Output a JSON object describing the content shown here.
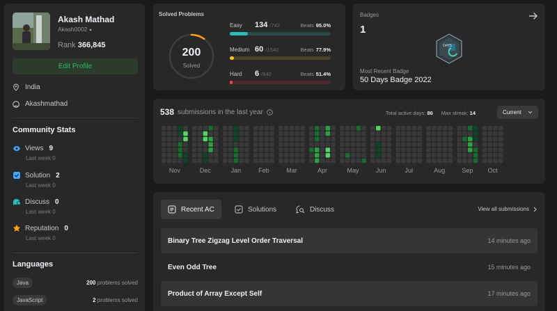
{
  "profile": {
    "name": "Akash Mathad",
    "handle": "Akash0002",
    "rank_label": "Rank",
    "rank_value": "366,845",
    "edit_label": "Edit Profile",
    "location": "India",
    "github": "Akashmathad"
  },
  "community": {
    "title": "Community Stats",
    "items": [
      {
        "label": "Views",
        "value": "9",
        "sub": "Last week 0",
        "icon": "eye-icon",
        "color": "#3ea6ff"
      },
      {
        "label": "Solution",
        "value": "2",
        "sub": "Last week 0",
        "icon": "solution-check-icon",
        "color": "#3ea6ff"
      },
      {
        "label": "Discuss",
        "value": "0",
        "sub": "Last week 0",
        "icon": "discuss-icon",
        "color": "#2cbbb8"
      },
      {
        "label": "Reputation",
        "value": "0",
        "sub": "Last week 0",
        "icon": "star-icon",
        "color": "#ffa116"
      }
    ]
  },
  "languages": {
    "title": "Languages",
    "items": [
      {
        "name": "Java",
        "count": "200",
        "suffix": "problems solved"
      },
      {
        "name": "JavaScript",
        "count": "2",
        "suffix": "problems solved"
      }
    ]
  },
  "solved": {
    "title": "Solved Problems",
    "total": "200",
    "total_label": "Solved",
    "ring_fraction": 0.1,
    "difficulties": [
      {
        "name": "Easy",
        "solved": "134",
        "total": "/742",
        "beats_label": "Beats",
        "beats": "95.0%",
        "fraction": 0.181,
        "fill": "#2cbbb8",
        "track": "#2a4a47"
      },
      {
        "name": "Medium",
        "solved": "60",
        "total": "/1540",
        "beats_label": "Beats",
        "beats": "77.9%",
        "fraction": 0.039,
        "fill": "#ffc01e",
        "track": "#4d4226"
      },
      {
        "name": "Hard",
        "solved": "6",
        "total": "/640",
        "beats_label": "Beats",
        "beats": "51.4%",
        "fraction": 0.009,
        "fill": "#ef4743",
        "track": "#4d2a29"
      }
    ]
  },
  "badges": {
    "label": "Badges",
    "count": "1",
    "recent_label": "Most Recent Badge",
    "recent_name": "50 Days Badge 2022",
    "badge_text": "DAYS"
  },
  "submissions": {
    "count": "538",
    "label": "submissions in the last year",
    "active_label": "Total active days:",
    "active_value": "86",
    "streak_label": "Max streak:",
    "streak_value": "14",
    "period": "Current",
    "months": [
      "Nov",
      "Dec",
      "Jan",
      "Feb",
      "Mar",
      "Apr",
      "May",
      "Jun",
      "Jul",
      "Aug",
      "Sep",
      "Oct"
    ],
    "levels": [
      "#393939",
      "#0e4429",
      "#196c2e",
      "#2ea043",
      "#56d364"
    ]
  },
  "recent": {
    "tabs": [
      {
        "label": "Recent AC",
        "icon": "list-icon"
      },
      {
        "label": "Solutions",
        "icon": "solutions-icon"
      },
      {
        "label": "Discuss",
        "icon": "discuss-search-icon"
      }
    ],
    "view_all": "View all submissions",
    "rows": [
      {
        "name": "Binary Tree Zigzag Level Order Traversal",
        "time": "14 minutes ago"
      },
      {
        "name": "Even Odd Tree",
        "time": "15 minutes ago"
      },
      {
        "name": "Product of Array Except Self",
        "time": "17 minutes ago"
      }
    ]
  }
}
